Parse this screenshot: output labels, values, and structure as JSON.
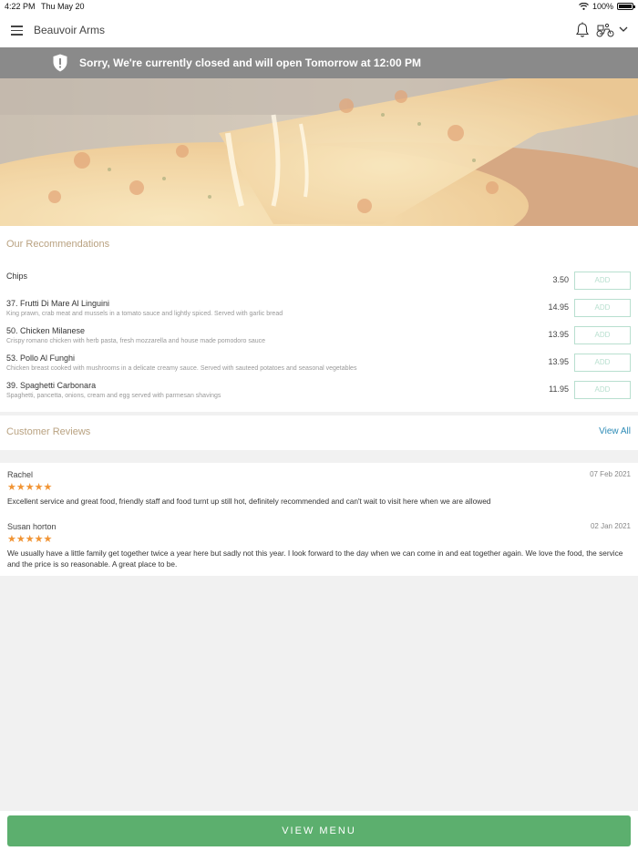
{
  "status_bar": {
    "time": "4:22 PM",
    "date": "Thu May 20",
    "battery": "100%"
  },
  "header": {
    "venue_name": "Beauvoir Arms"
  },
  "notice": {
    "message": "Sorry, We're currently closed and will open Tomorrow at 12:00 PM"
  },
  "recommendations": {
    "title": "Our Recommendations",
    "add_label": "ADD",
    "items": [
      {
        "name": "Chips",
        "description": "",
        "price": "3.50"
      },
      {
        "name": "37. Frutti Di Mare Al Linguini",
        "description": "King prawn, crab meat and mussels in a tomato sauce and lightly spiced. Served with garlic bread",
        "price": "14.95"
      },
      {
        "name": "50. Chicken Milanese",
        "description": "Crispy romano chicken with herb pasta, fresh mozzarella and house made pomodoro sauce",
        "price": "13.95"
      },
      {
        "name": "53. Pollo Al Funghi",
        "description": "Chicken breast cooked with mushrooms in a delicate creamy sauce. Served with sauteed potatoes and seasonal vegetables",
        "price": "13.95"
      },
      {
        "name": "39. Spaghetti Carbonara",
        "description": "Spaghetti, pancetta, onions, cream and egg served with parmesan shavings",
        "price": "11.95"
      }
    ]
  },
  "reviews": {
    "title": "Customer Reviews",
    "view_all": "View All",
    "items": [
      {
        "author": "Rachel",
        "date": "07 Feb 2021",
        "stars": "★★★★★",
        "rating": 5,
        "text": "Excellent service and great food, friendly staff and food turnt up still hot, definitely recommended and can't wait to visit here when we are allowed"
      },
      {
        "author": "Susan horton",
        "date": "02 Jan 2021",
        "stars": "★★★★★",
        "rating": 5,
        "text": "We usually have a little family get together twice a year here but sadly not this year. I look forward to the day when we can come in and eat together again. We love the food, the service and the price is so reasonable. A great place to be."
      }
    ]
  },
  "footer": {
    "view_menu_label": "VIEW MENU"
  },
  "colors": {
    "accent": "#5caf6e",
    "section_title": "#b9a281",
    "link": "#2d8bb6",
    "star": "#f19434",
    "notice_bg": "#8a8a8a",
    "add_border": "#b8dfcf"
  },
  "icons": {
    "menu": "hamburger-icon",
    "notifications": "bell-icon",
    "delivery": "scooter-icon",
    "expand": "chevron-down-icon",
    "notice": "shield-alert-icon"
  }
}
